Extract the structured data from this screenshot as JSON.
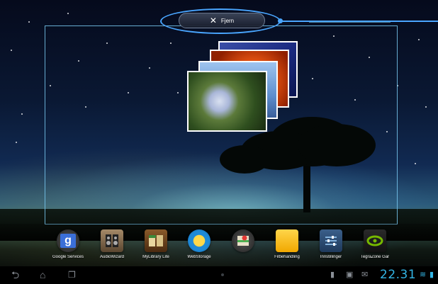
{
  "remove_bar": {
    "label": "Fjern",
    "icon": "close-icon"
  },
  "dock": {
    "apps": [
      {
        "label": "Google Services",
        "icon": "google-services-icon"
      },
      {
        "label": "AudioWizard",
        "icon": "audiowizard-icon"
      },
      {
        "label": "MyLibrary Lite",
        "icon": "mylibrary-icon"
      },
      {
        "label": "WebStorage",
        "icon": "webstorage-icon"
      },
      {
        "label": "",
        "icon": "maps-icon"
      },
      {
        "label": "Filbehandling",
        "icon": "folder-icon"
      },
      {
        "label": "Innstillinger",
        "icon": "settings-icon"
      },
      {
        "label": "TegraZone Gar",
        "icon": "tegrazone-icon"
      }
    ]
  },
  "navbar": {
    "back_icon": "back-icon",
    "home_icon": "home-icon",
    "recents_icon": "recents-icon"
  },
  "status": {
    "time": "22.31",
    "icons": [
      "screenshot-icon",
      "gallery-icon",
      "mail-icon",
      "wifi-icon",
      "battery-icon"
    ]
  },
  "colors": {
    "accent": "#33b5e5",
    "highlight": "#4aa6ff"
  }
}
